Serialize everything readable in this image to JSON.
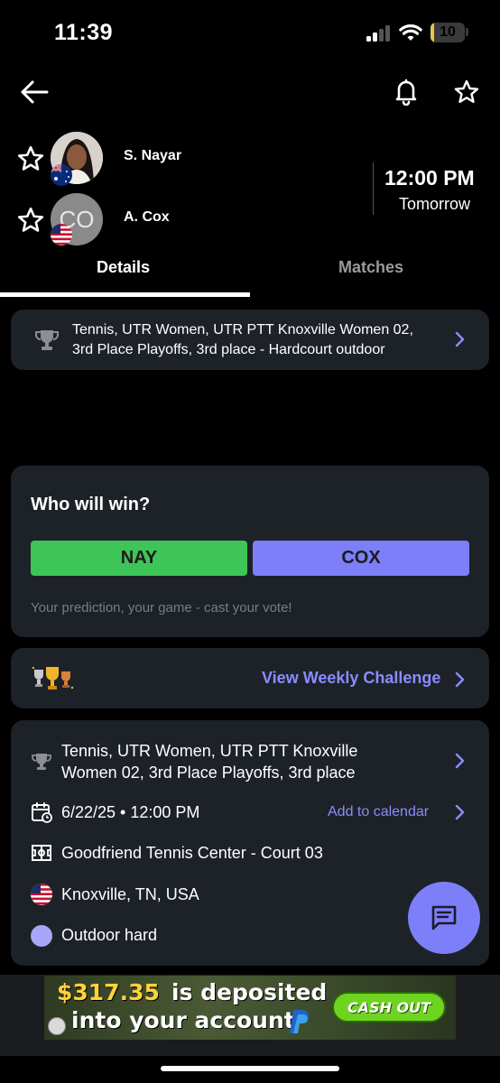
{
  "status_bar": {
    "time": "11:39",
    "battery": "10",
    "battery_level": 0.1,
    "battery_color": "#e8c44a"
  },
  "nav": {
    "back_icon": "arrow-left-icon",
    "bell_icon": "bell-icon",
    "star_icon": "star-outline-icon"
  },
  "players": [
    {
      "name": "S. Nayar",
      "initials": "",
      "flag": "australia-flag"
    },
    {
      "name": "A. Cox",
      "initials": "CO",
      "flag": "usa-flag"
    }
  ],
  "match": {
    "time": "12:00 PM",
    "day": "Tomorrow"
  },
  "tabs": [
    {
      "label": "Details",
      "active": true
    },
    {
      "label": "Matches",
      "active": false
    }
  ],
  "tournament": {
    "line1": "Tennis, UTR Women, UTR PTT Knoxville Women 02,",
    "line2": "3rd Place Playoffs, 3rd place - Hardcourt outdoor"
  },
  "vote": {
    "title": "Who will win?",
    "option_a": "NAY",
    "option_b": "COX",
    "hint": "Your prediction, your game - cast your vote!",
    "colors": {
      "option_a": "#3ec557",
      "option_b": "#7d7ff9"
    }
  },
  "challenge": {
    "link": "View Weekly Challenge"
  },
  "info": {
    "title_line1": "Tennis, UTR Women, UTR PTT Knoxville",
    "title_line2": "Women 02, 3rd Place Playoffs, 3rd place",
    "date": "6/22/25 • 12:00 PM",
    "calendar_link": "Add to calendar",
    "venue": "Goodfriend Tennis Center - Court 03",
    "location": "Knoxville, TN, USA",
    "surface": "Outdoor hard"
  },
  "ad": {
    "amount": "$317.35",
    "text1": "is deposited",
    "text2": "into your account",
    "button": "CASH OUT"
  },
  "colors": {
    "accent": "#8a8cff",
    "card_bg": "#1d2228",
    "background": "#000000"
  }
}
